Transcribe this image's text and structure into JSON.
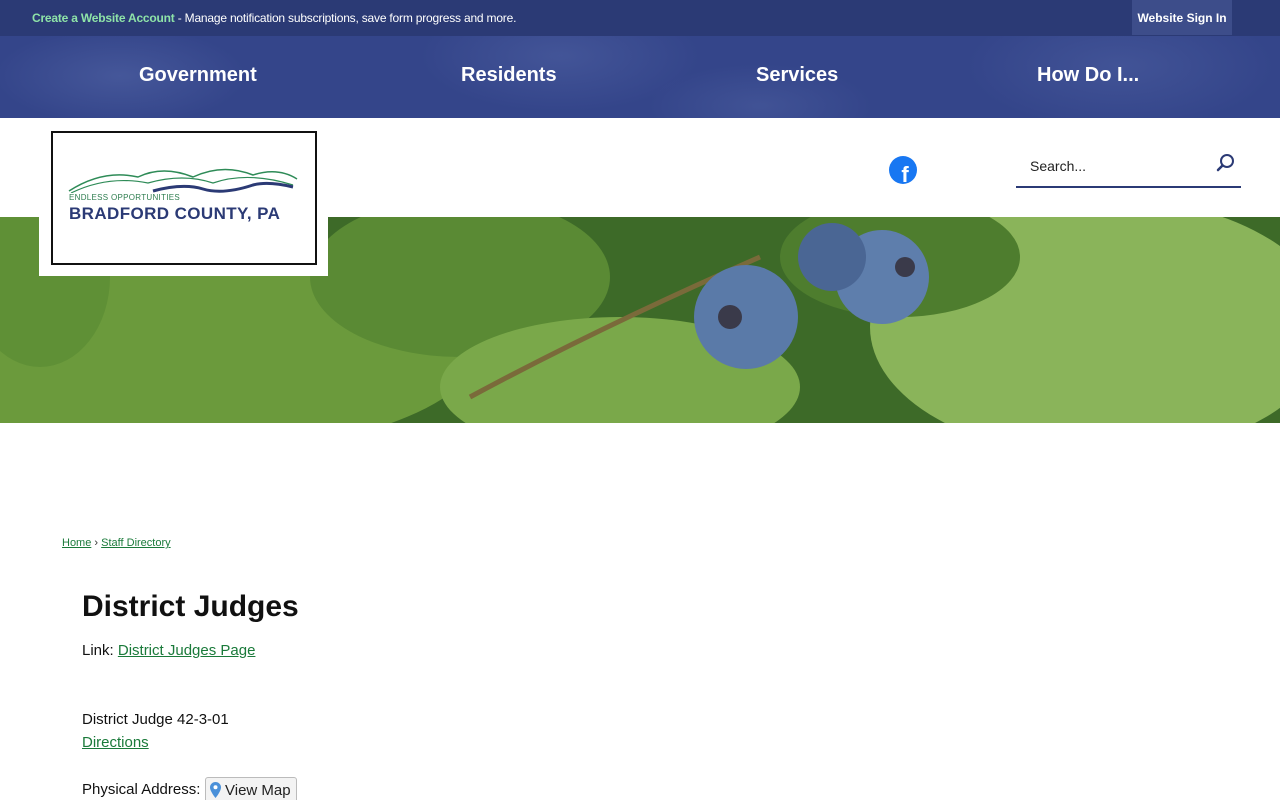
{
  "topbar": {
    "account_link": "Create a Website Account",
    "account_desc": " - Manage notification subscriptions, save form progress and more.",
    "sign_in": "Website Sign In"
  },
  "nav": {
    "items": [
      "Government",
      "Residents",
      "Services",
      "How Do I..."
    ]
  },
  "logo": {
    "tagline": "ENDLESS OPPORTUNITIES",
    "name": "BRADFORD COUNTY, PA"
  },
  "social": {
    "icon": "facebook-icon"
  },
  "search": {
    "placeholder": "Search..."
  },
  "breadcrumb": {
    "home": "Home",
    "separator": "›",
    "current": "Staff Directory"
  },
  "page": {
    "title": "District Judges",
    "link_label": "Link: ",
    "link_text": "District Judges Page",
    "judge_name": "District Judge 42-3-01",
    "directions": "Directions",
    "physical_address_label": "Physical Address:",
    "view_map": "View Map"
  },
  "colors": {
    "topbar": "#2b3a75",
    "nav": "#34458a",
    "link_green": "#1a7a3a",
    "accent_green": "#8ee3a8"
  }
}
